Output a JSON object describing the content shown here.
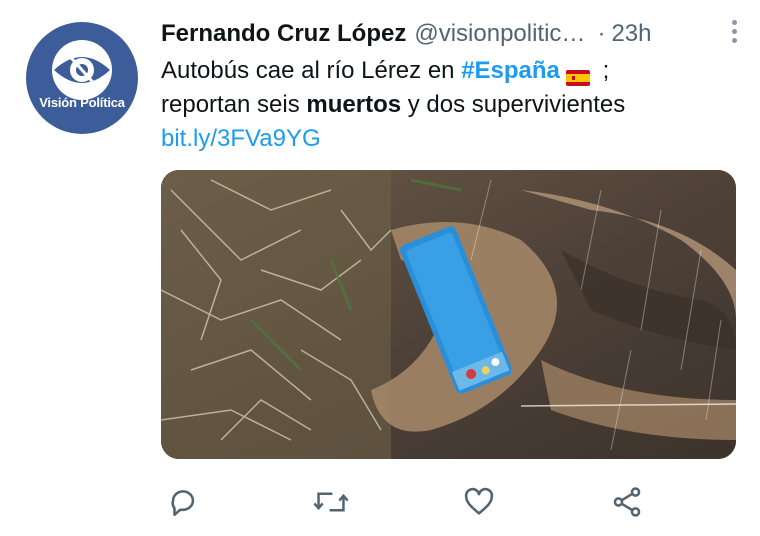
{
  "tweet": {
    "author_name": "Fernando Cruz López",
    "handle": "@visionpolitic…",
    "separator": "·",
    "time": "23h",
    "avatar_label": "Visión Política",
    "text_part1": "Autobús cae al río Lérez en ",
    "hashtag": "#España",
    "text_part2": " ;",
    "text_part3": "reportan seis ",
    "text_bold": "muertos",
    "text_part4": " y dos supervivientes",
    "link": "bit.ly/3FVa9YG",
    "flag_icon": "spain-flag-icon"
  },
  "actions": {
    "reply_icon": "reply-icon",
    "retweet_icon": "retweet-icon",
    "like_icon": "heart-icon",
    "share_icon": "share-icon"
  },
  "colors": {
    "link": "#1d9bf0",
    "secondary_text": "#536471",
    "avatar_bg": "#3d5c9a"
  }
}
